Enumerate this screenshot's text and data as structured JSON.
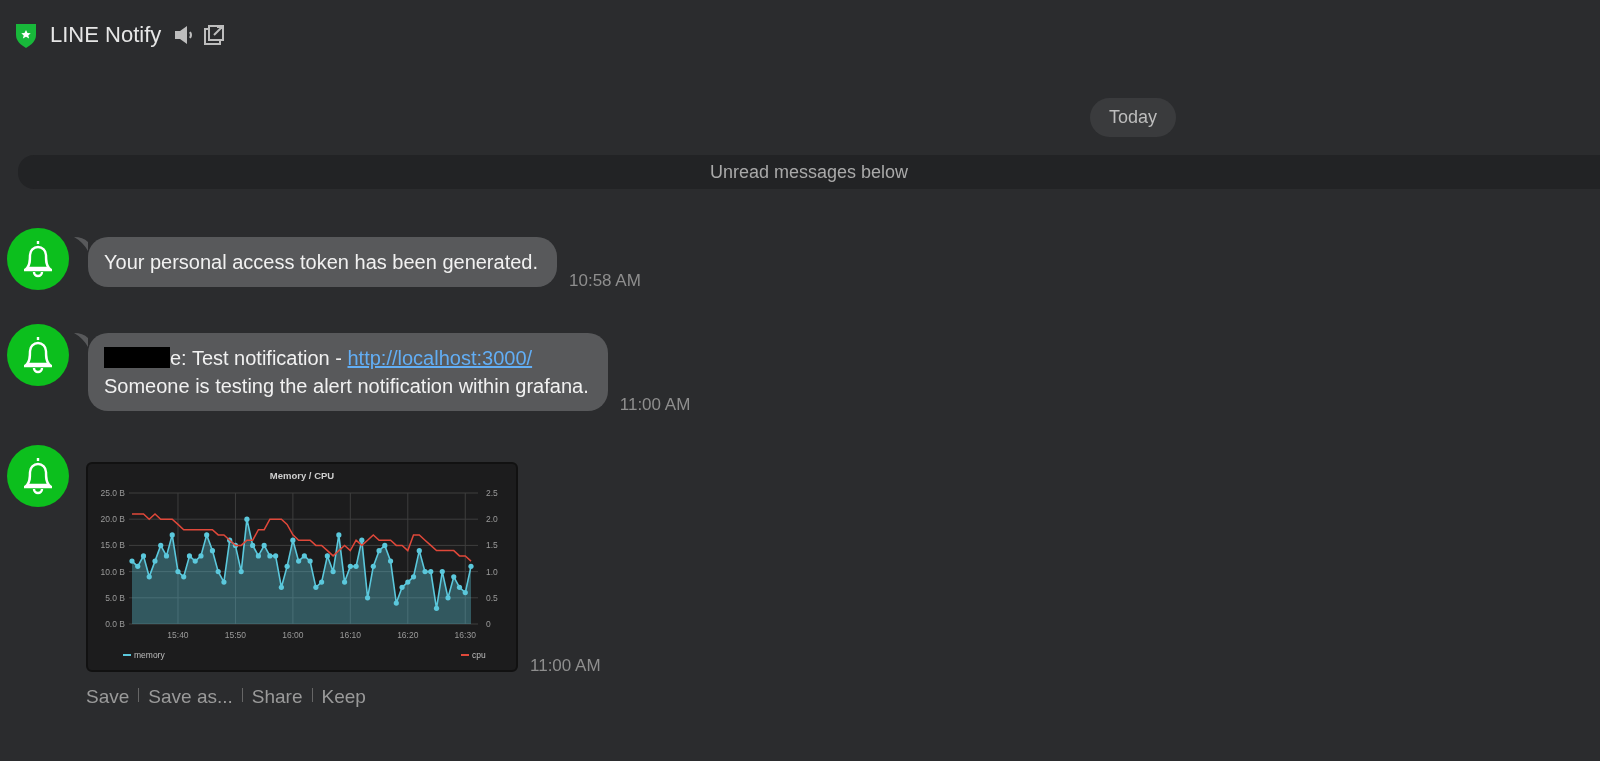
{
  "header": {
    "title": "LINE Notify"
  },
  "date_pill": "Today",
  "unread_divider": "Unread messages below",
  "messages": [
    {
      "kind": "text",
      "lines": [
        {
          "redacted": false,
          "text": "Your personal access token has been generated."
        }
      ],
      "time": "10:58 AM"
    },
    {
      "kind": "text",
      "lines": [
        {
          "redacted": true,
          "text": "e: Test notification - ",
          "link": "http://localhost:3000/"
        },
        {
          "redacted": false,
          "text": "Someone is testing the alert notification within grafana."
        }
      ],
      "time": "11:00 AM"
    },
    {
      "kind": "image",
      "time": "11:00 AM",
      "actions": [
        "Save",
        "Save as...",
        "Share",
        "Keep"
      ],
      "chart_data": {
        "type": "area",
        "title": "Memory / CPU",
        "grid": true,
        "legend": "bottom",
        "categories": [
          null,
          null,
          null,
          null,
          null,
          null,
          null,
          null,
          "15:40",
          null,
          null,
          null,
          null,
          null,
          null,
          null,
          null,
          null,
          "15:50",
          null,
          null,
          null,
          null,
          null,
          null,
          null,
          null,
          null,
          "16:00",
          null,
          null,
          null,
          null,
          null,
          null,
          null,
          null,
          null,
          "16:10",
          null,
          null,
          null,
          null,
          null,
          null,
          null,
          null,
          null,
          "16:20",
          null,
          null,
          null,
          null,
          null,
          null,
          null,
          null,
          null,
          "16:30",
          null
        ],
        "series": [
          {
            "name": "memory",
            "color": "#5bc8dc",
            "values": [
              12,
              11,
              13,
              9,
              12,
              15,
              13,
              17,
              10,
              9,
              13,
              12,
              13,
              17,
              14,
              10,
              8,
              16,
              15,
              10,
              20,
              15,
              13,
              15,
              13,
              13,
              7,
              11,
              16,
              12,
              13,
              12,
              7,
              8,
              13,
              10,
              17,
              8,
              11,
              11,
              16,
              5,
              11,
              14,
              15,
              12,
              4,
              7,
              8,
              9,
              14,
              10,
              10,
              3,
              10,
              5,
              9,
              7,
              6,
              11
            ]
          },
          {
            "name": "cpu",
            "color": "#e0483a",
            "axis": "y2",
            "type": "line",
            "values": [
              2.1,
              2.1,
              2.1,
              2.0,
              2.1,
              2.0,
              2.0,
              2.0,
              1.9,
              1.8,
              1.8,
              1.8,
              1.8,
              1.8,
              1.8,
              1.7,
              1.7,
              1.6,
              1.5,
              1.5,
              1.6,
              1.6,
              1.8,
              1.8,
              2.0,
              2.0,
              2.0,
              1.9,
              1.7,
              1.6,
              1.6,
              1.6,
              1.5,
              1.5,
              1.4,
              1.3,
              1.4,
              1.5,
              1.4,
              1.6,
              1.5,
              1.6,
              1.7,
              1.6,
              1.6,
              1.6,
              1.5,
              1.5,
              1.4,
              1.7,
              1.7,
              1.6,
              1.5,
              1.4,
              1.4,
              1.4,
              1.4,
              1.3,
              1.3,
              1.2
            ]
          }
        ],
        "ylim": [
          0,
          25
        ],
        "yticks": [
          {
            "value": 0,
            "label": "0.0 B"
          },
          {
            "value": 5,
            "label": "5.0 B"
          },
          {
            "value": 10,
            "label": "10.0 B"
          },
          {
            "value": 15,
            "label": "15.0 B"
          },
          {
            "value": 20,
            "label": "20.0 B"
          },
          {
            "value": 25,
            "label": "25.0 B"
          }
        ],
        "y2lim": [
          0,
          2.5
        ],
        "y2ticks": [
          {
            "value": 0,
            "label": "0"
          },
          {
            "value": 0.5,
            "label": "0.5"
          },
          {
            "value": 1,
            "label": "1.0"
          },
          {
            "value": 1.5,
            "label": "1.5"
          },
          {
            "value": 2,
            "label": "2.0"
          },
          {
            "value": 2.5,
            "label": "2.5"
          }
        ]
      }
    }
  ]
}
